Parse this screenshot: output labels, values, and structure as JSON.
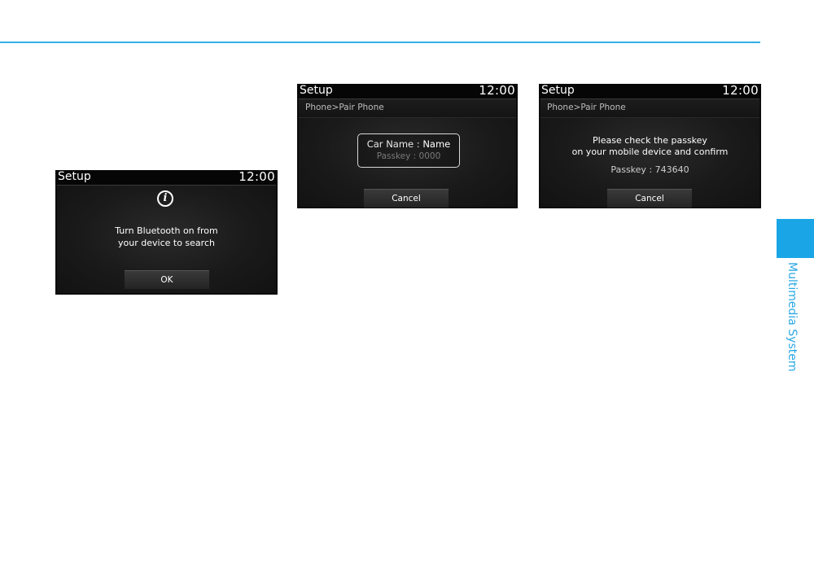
{
  "side_tab": {
    "label": "Multimedia System",
    "color": "#1aa6e6"
  },
  "accent_color": "#35aee8",
  "screens": [
    {
      "title": "Setup",
      "clock": "12:00",
      "icon": "info-icon",
      "message_line1": "Turn Bluetooth on from",
      "message_line2": "your device to search",
      "button": "OK"
    },
    {
      "title": "Setup",
      "clock": "12:00",
      "breadcrumb": "Phone>Pair Phone",
      "car_name_label": "Car Name : ",
      "car_name_value": "Name",
      "passkey": "Passkey : 0000",
      "button": "Cancel"
    },
    {
      "title": "Setup",
      "clock": "12:00",
      "breadcrumb": "Phone>Pair Phone",
      "message_line1": "Please check the passkey",
      "message_line2": "on your mobile device and confirm",
      "passkey": "Passkey : 743640",
      "button": "Cancel"
    }
  ]
}
